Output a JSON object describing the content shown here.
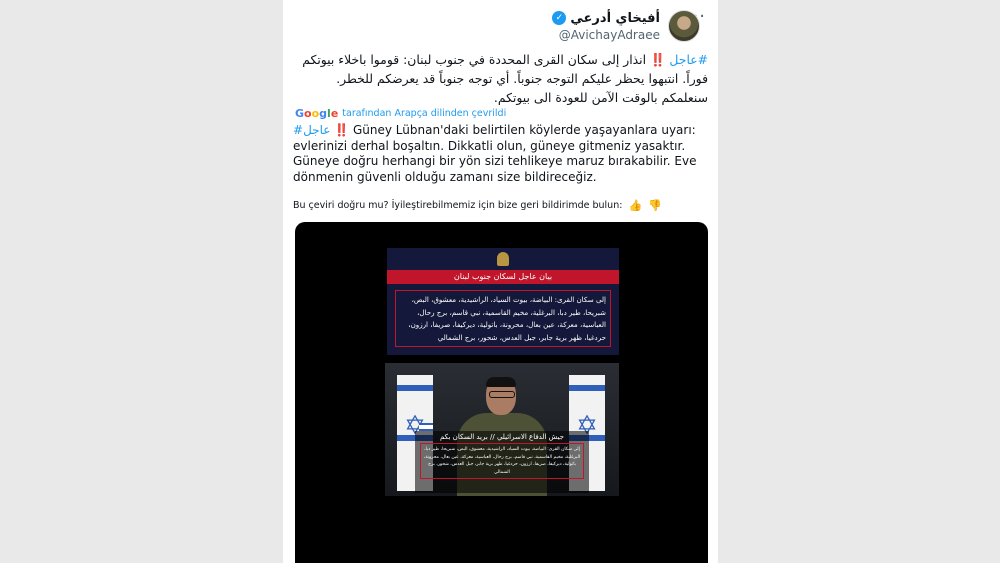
{
  "tweet": {
    "display_name": "أفيخاي أدرعي",
    "handle": "@AvichayAdraee",
    "more_label": "···",
    "verified_icon": "verified-badge-icon",
    "text_ar": {
      "hashtag": "#عاجل",
      "bang": "‼️",
      "body": "انذار إلى سكان القرى المحددة في جنوب لبنان: قوموا باخلاء بيوتكم فوراً. انتبهوا يحظر عليكم التوجه جنوباً. أي توجه جنوباً قد يعرضكم للخطر. سنعلمكم بالوقت الآمن للعودة الى بيوتكم."
    },
    "translation": {
      "brand": "Google",
      "label": "tarafından Arapça dilinden çevrildi",
      "hashtag": "#عاجل",
      "bang": "‼️",
      "body": "Güney Lübnan'daki belirtilen köylerde yaşayanlara uyarı: evlerinizi derhal boşaltın. Dikkatli olun, güneye gitmeniz yasaktır. Güneye doğru herhangi bir yön sizi tehlikeye maruz bırakabilir. Eve dönmenin güvenli olduğu zamanı size bildireceğiz."
    },
    "feedback": {
      "label": "Bu çeviri doğru mu? İyileştirebilmemiz için bize geri bildirimde bulun:",
      "like_icon": "thumbs-up-icon",
      "dislike_icon": "thumbs-down-icon"
    }
  },
  "media": {
    "notice_title": "بيان عاجل لسكان جنوب لبنان",
    "notice_body": "إلى سكان القرى: البياضة، بيوت السياد، الراشيدية، معشوق، البص، شبريحا، طير دبا، البرغلية، مخيم القاسمية، نبي قاسم، برج رحال، العباسية، معركة، عين بعال، محرونة، باتولية، ديركيفا، صريفا، ارزون، حردغيا، ظهر برية جابر، جبل العدس، شحور، برج الشمالي",
    "overlay_title": "جيش الدفاع الاسرائيلي // بريد السكان بكم",
    "overlay_body": "إلى سكان القرى: البياضة، بيوت السياد، الراشيدية، معشوق، البص، شبريحا، طير دبا، البرغلية، مخيم القاسمية، نبي قاسم، برج رحال، العباسية، معركة، عين بعال، محرونة، باتولية، ديركيفا، صريفا، ارزون، حردغيا، ظهر برية جابر، جبل العدس، شحور، برج الشمالي"
  },
  "colors": {
    "accent": "#1d9bf0",
    "alert_red": "#c0152a",
    "notice_bg": "#14183a"
  }
}
